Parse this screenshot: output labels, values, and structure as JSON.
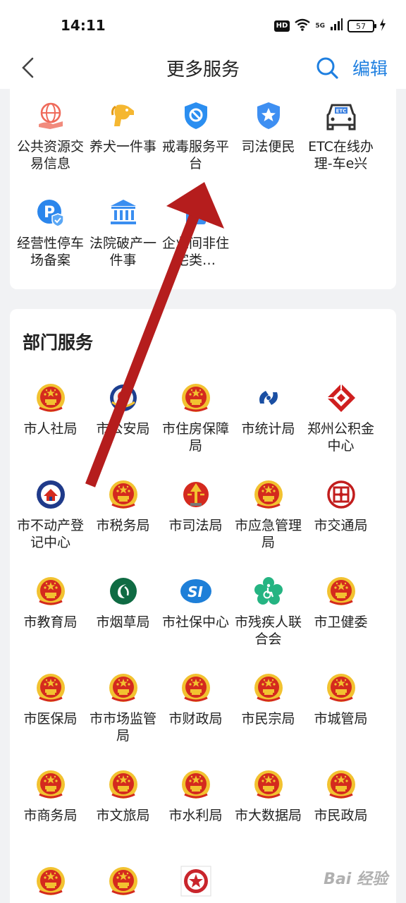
{
  "status": {
    "time": "14:11",
    "hd": "HD",
    "network": "5G",
    "battery": "57"
  },
  "nav": {
    "title": "更多服务",
    "edit": "编辑"
  },
  "top_services": [
    {
      "label": "公共资源交易信息",
      "icon": "globe-hand-icon"
    },
    {
      "label": "养犬一件事",
      "icon": "dog-icon"
    },
    {
      "label": "戒毒服务平台",
      "icon": "shield-forbid-icon"
    },
    {
      "label": "司法便民",
      "icon": "shield-star-icon"
    },
    {
      "label": "ETC在线办理-车e兴",
      "icon": "etc-car-icon"
    },
    {
      "label": "经营性停车场备案",
      "icon": "parking-icon"
    },
    {
      "label": "法院破产一件事",
      "icon": "court-icon"
    },
    {
      "label": "企业间非住宅类…",
      "icon": "building-icon"
    }
  ],
  "dept_section": {
    "title": "部门服务"
  },
  "dept_services": [
    {
      "label": "市人社局",
      "icon": "national-emblem-icon"
    },
    {
      "label": "市公安局",
      "icon": "police-emblem-icon"
    },
    {
      "label": "市住房保障局",
      "icon": "national-emblem-icon"
    },
    {
      "label": "市统计局",
      "icon": "statistics-logo-icon"
    },
    {
      "label": "郑州公积金中心",
      "icon": "housing-fund-logo-icon"
    },
    {
      "label": "市不动产登记中心",
      "icon": "real-estate-logo-icon"
    },
    {
      "label": "市税务局",
      "icon": "national-emblem-icon"
    },
    {
      "label": "市司法局",
      "icon": "justice-emblem-icon"
    },
    {
      "label": "市应急管理局",
      "icon": "national-emblem-icon"
    },
    {
      "label": "市交通局",
      "icon": "transport-logo-icon"
    },
    {
      "label": "市教育局",
      "icon": "national-emblem-icon"
    },
    {
      "label": "市烟草局",
      "icon": "tobacco-logo-icon"
    },
    {
      "label": "市社保中心",
      "icon": "social-security-logo-icon"
    },
    {
      "label": "市残疾人联合会",
      "icon": "disabled-federation-logo-icon"
    },
    {
      "label": "市卫健委",
      "icon": "national-emblem-icon"
    },
    {
      "label": "市医保局",
      "icon": "national-emblem-icon"
    },
    {
      "label": "市市场监管局",
      "icon": "national-emblem-icon"
    },
    {
      "label": "市财政局",
      "icon": "national-emblem-icon"
    },
    {
      "label": "市民宗局",
      "icon": "national-emblem-icon"
    },
    {
      "label": "市城管局",
      "icon": "national-emblem-icon"
    },
    {
      "label": "市商务局",
      "icon": "national-emblem-icon"
    },
    {
      "label": "市文旅局",
      "icon": "national-emblem-icon"
    },
    {
      "label": "市水利局",
      "icon": "national-emblem-icon"
    },
    {
      "label": "市大数据局",
      "icon": "national-emblem-icon"
    },
    {
      "label": "市民政局",
      "icon": "national-emblem-icon"
    },
    {
      "label": "",
      "icon": "national-emblem-icon"
    },
    {
      "label": "",
      "icon": "national-emblem-icon"
    },
    {
      "label": "",
      "icon": "red-cross-star-icon"
    }
  ],
  "watermark": "Bai 经验",
  "colors": {
    "accent": "#1e7fe0",
    "arrow": "#b51d1d",
    "emblem": "#d42a1e",
    "gold": "#f2c230"
  }
}
